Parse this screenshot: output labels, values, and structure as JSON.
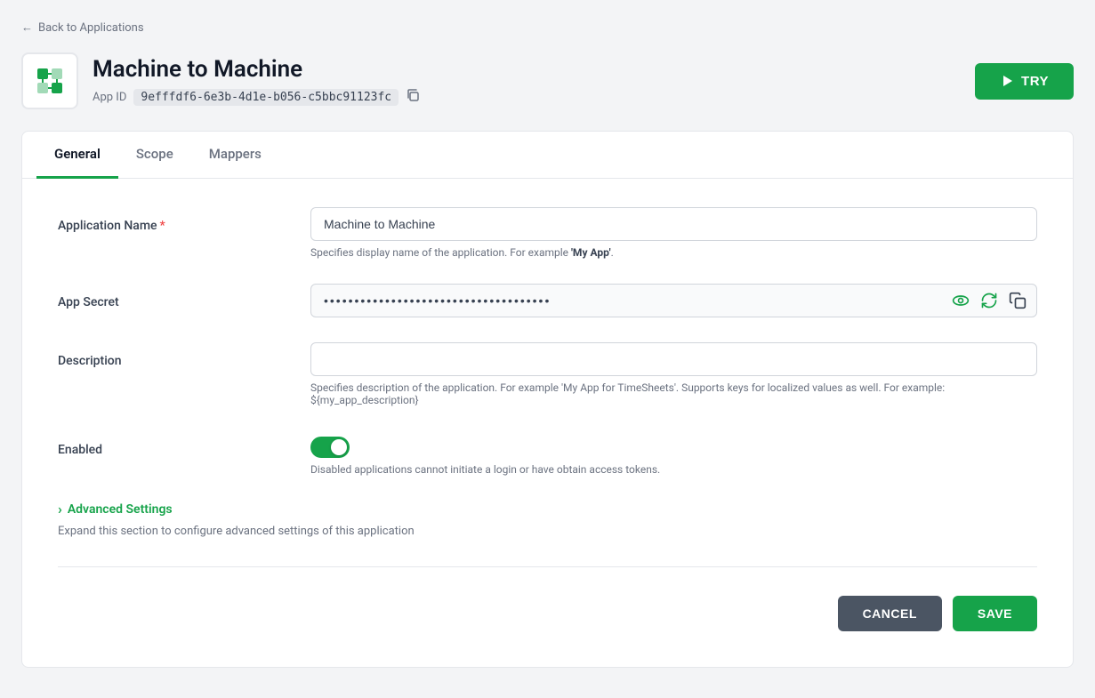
{
  "nav": {
    "back_label": "Back to Applications"
  },
  "app": {
    "title": "Machine to Machine",
    "id_label": "App ID",
    "id_value": "9efffdf6-6e3b-4d1e-b056-c5bbc91123fc",
    "try_label": "TRY"
  },
  "tabs": [
    {
      "id": "general",
      "label": "General",
      "active": true
    },
    {
      "id": "scope",
      "label": "Scope",
      "active": false
    },
    {
      "id": "mappers",
      "label": "Mappers",
      "active": false
    }
  ],
  "form": {
    "app_name_label": "Application Name",
    "app_name_required": true,
    "app_name_value": "Machine to Machine",
    "app_name_hint": "Specifies display name of the application. For example ",
    "app_name_hint_bold": "'My App'",
    "app_name_hint_end": ".",
    "app_secret_label": "App Secret",
    "app_secret_value": "••••••••••••••••••••••••••••••••••••••••••••••••••••••••••••••••",
    "description_label": "Description",
    "description_value": "",
    "description_placeholder": "",
    "description_hint": "Specifies description of the application. For example 'My App for TimeSheets'. Supports keys for localized values as well. For example: ${my_app_description}",
    "enabled_label": "Enabled",
    "enabled_hint": "Disabled applications cannot initiate a login or have obtain access tokens.",
    "advanced_label": "Advanced Settings",
    "advanced_desc": "Expand this section to configure advanced settings of this application"
  },
  "actions": {
    "cancel_label": "CANCEL",
    "save_label": "SAVE"
  },
  "icons": {
    "back_arrow": "←",
    "copy": "⧉",
    "eye": "👁",
    "refresh": "↺",
    "chevron_right": "›"
  }
}
